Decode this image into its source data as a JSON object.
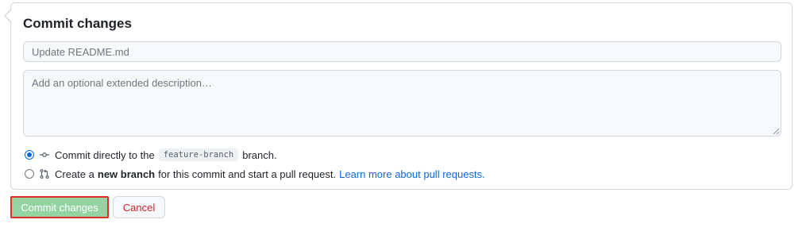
{
  "commit_form": {
    "title": "Commit changes",
    "summary_placeholder": "Update README.md",
    "description_placeholder": "Add an optional extended description…",
    "option_direct": {
      "prefix": "Commit directly to the",
      "branch": "feature-branch",
      "suffix": "branch.",
      "selected": true
    },
    "option_new_branch": {
      "prefix": "Create a",
      "bold": "new branch",
      "suffix": "for this commit and start a pull request.",
      "link": "Learn more about pull requests.",
      "selected": false
    }
  },
  "actions": {
    "commit_label": "Commit changes",
    "cancel_label": "Cancel"
  },
  "colors": {
    "commit_button_bg": "#94d3a2",
    "commit_button_highlight": "#e02d25",
    "cancel_text": "#cf222e",
    "link": "#0969da"
  }
}
